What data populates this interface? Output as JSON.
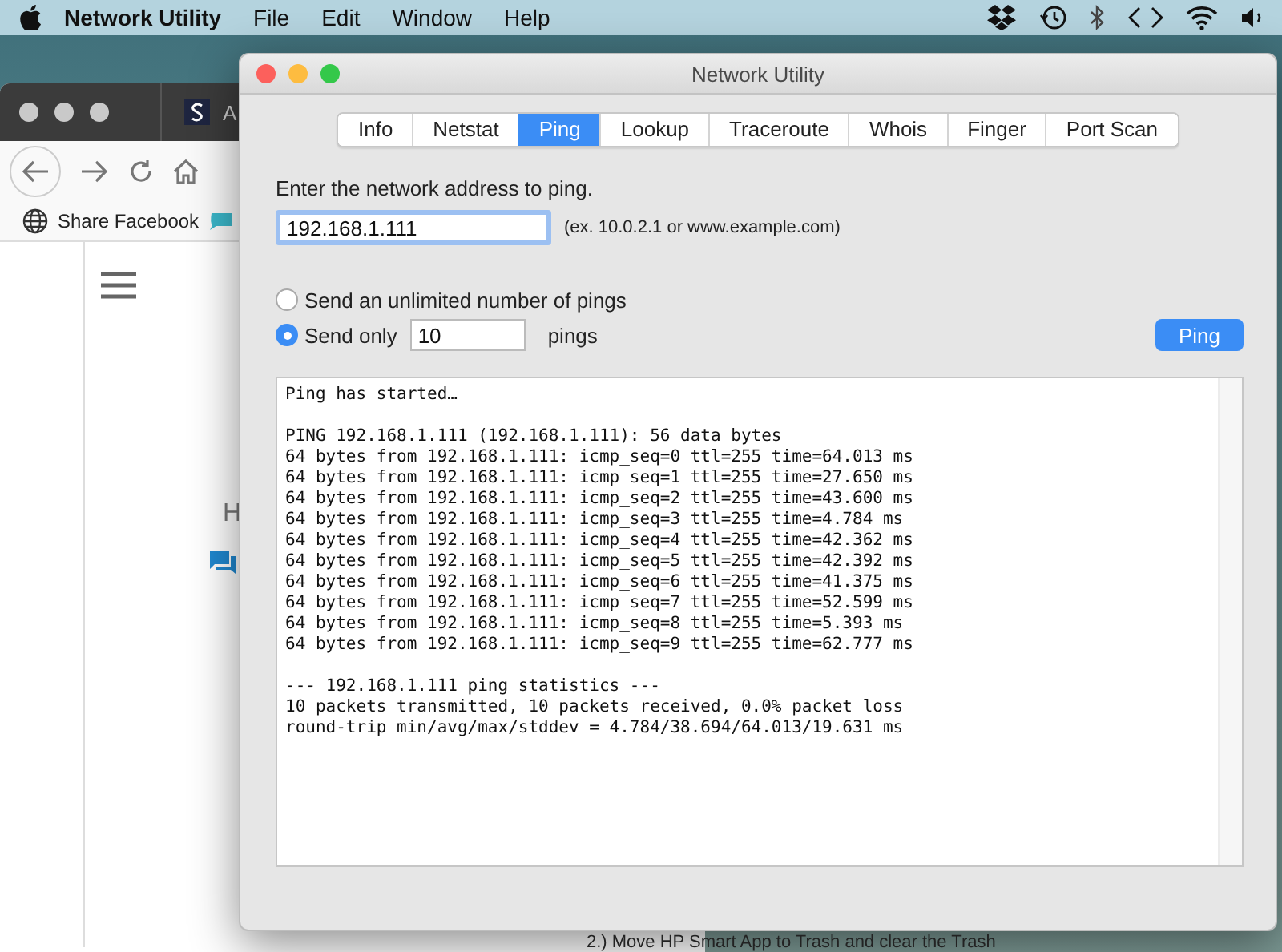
{
  "menu_bar": {
    "app_name": "Network Utility",
    "items": [
      "File",
      "Edit",
      "Window",
      "Help"
    ]
  },
  "browser_window": {
    "tab_title": "A",
    "bookmark": "Share Facebook",
    "heading": "H",
    "footer_text": "2.) Move HP Smart App to Trash and clear the Trash"
  },
  "window": {
    "title": "Network Utility",
    "tabs": [
      {
        "label": "Info",
        "selected": false
      },
      {
        "label": "Netstat",
        "selected": false
      },
      {
        "label": "Ping",
        "selected": true
      },
      {
        "label": "Lookup",
        "selected": false
      },
      {
        "label": "Traceroute",
        "selected": false
      },
      {
        "label": "Whois",
        "selected": false
      },
      {
        "label": "Finger",
        "selected": false
      },
      {
        "label": "Port Scan",
        "selected": false
      }
    ],
    "address_label": "Enter the network address to ping.",
    "address_value": "192.168.1.111",
    "address_hint": "(ex. 10.0.2.1 or www.example.com)",
    "options": [
      {
        "label": "Send an unlimited number of pings",
        "selected": false
      },
      {
        "label": "Send only",
        "selected": true,
        "count": "10",
        "suffix": "pings"
      }
    ],
    "ping_button": "Ping",
    "output": [
      [
        "Ping has started…"
      ],
      [
        "PING 192.168.1.111 (192.168.1.111): 56 data bytes",
        "64 bytes from 192.168.1.111: icmp_seq=0 ttl=255 time=64.013 ms",
        "64 bytes from 192.168.1.111: icmp_seq=1 ttl=255 time=27.650 ms",
        "64 bytes from 192.168.1.111: icmp_seq=2 ttl=255 time=43.600 ms",
        "64 bytes from 192.168.1.111: icmp_seq=3 ttl=255 time=4.784 ms",
        "64 bytes from 192.168.1.111: icmp_seq=4 ttl=255 time=42.362 ms",
        "64 bytes from 192.168.1.111: icmp_seq=5 ttl=255 time=42.392 ms",
        "64 bytes from 192.168.1.111: icmp_seq=6 ttl=255 time=41.375 ms",
        "64 bytes from 192.168.1.111: icmp_seq=7 ttl=255 time=52.599 ms",
        "64 bytes from 192.168.1.111: icmp_seq=8 ttl=255 time=5.393 ms",
        "64 bytes from 192.168.1.111: icmp_seq=9 ttl=255 time=62.777 ms"
      ],
      [
        "--- 192.168.1.111 ping statistics ---",
        "10 packets transmitted, 10 packets received, 0.0% packet loss",
        "round-trip min/avg/max/stddev = 4.784/38.694/64.013/19.631 ms"
      ]
    ]
  }
}
